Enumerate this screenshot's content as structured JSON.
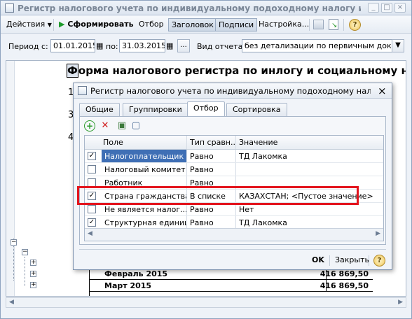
{
  "window": {
    "title": "Регистр налогового учета по индивидуальному подоходному налогу и социальному н...",
    "minimize": "_",
    "maximize": "□",
    "close": "×"
  },
  "toolbar": {
    "actions": "Действия",
    "generate": "Сформировать",
    "filter": "Отбор",
    "heading": "Заголовок",
    "signatures": "Подписи",
    "settings": "Настройка...",
    "help": "?"
  },
  "period": {
    "label_from": "Период с:",
    "from": "01.01.2015",
    "label_to": "по:",
    "to": "31.03.2015",
    "ellipsis": "...",
    "report_type_label": "Вид отчета:",
    "report_type": "без детализации по первичным документ"
  },
  "report": {
    "title_cursor": "Ф",
    "title_rest": "орма налогового регистра по инлогу и социальному нал",
    "left_digits": [
      "1",
      "3",
      "4"
    ],
    "rows": [
      {
        "label": "Февраль 2015",
        "value": "416 869,50"
      },
      {
        "label": "Март 2015",
        "value": "416 869,50"
      }
    ]
  },
  "dialog": {
    "title": "Регистр налогового учета по индивидуальному подоходному нало...",
    "close": "×",
    "tabs": [
      "Общие",
      "Группировки",
      "Отбор",
      "Сортировка"
    ],
    "columns": [
      "Поле",
      "Тип сравн...",
      "Значение"
    ],
    "rows": [
      {
        "checked": true,
        "field": "Налогоплательщик",
        "type": "Равно",
        "value": "ТД Лакомка"
      },
      {
        "checked": false,
        "field": "Налоговый комитет",
        "type": "Равно",
        "value": ""
      },
      {
        "checked": false,
        "field": "Работник",
        "type": "Равно",
        "value": ""
      },
      {
        "checked": true,
        "field": "Страна гражданства",
        "type": "В списке",
        "value": "КАЗАХСТАН; <Пустое значение>"
      },
      {
        "checked": false,
        "field": "Не является налог...",
        "type": "Равно",
        "value": "Нет"
      },
      {
        "checked": true,
        "field": "Структурная единица",
        "type": "Равно",
        "value": "ТД Лакомка"
      }
    ],
    "ok": "OK",
    "close_btn": "Закрыть",
    "help": "?"
  },
  "colors": {
    "highlight": "#e3141d",
    "selected": "#3f6fb5"
  }
}
